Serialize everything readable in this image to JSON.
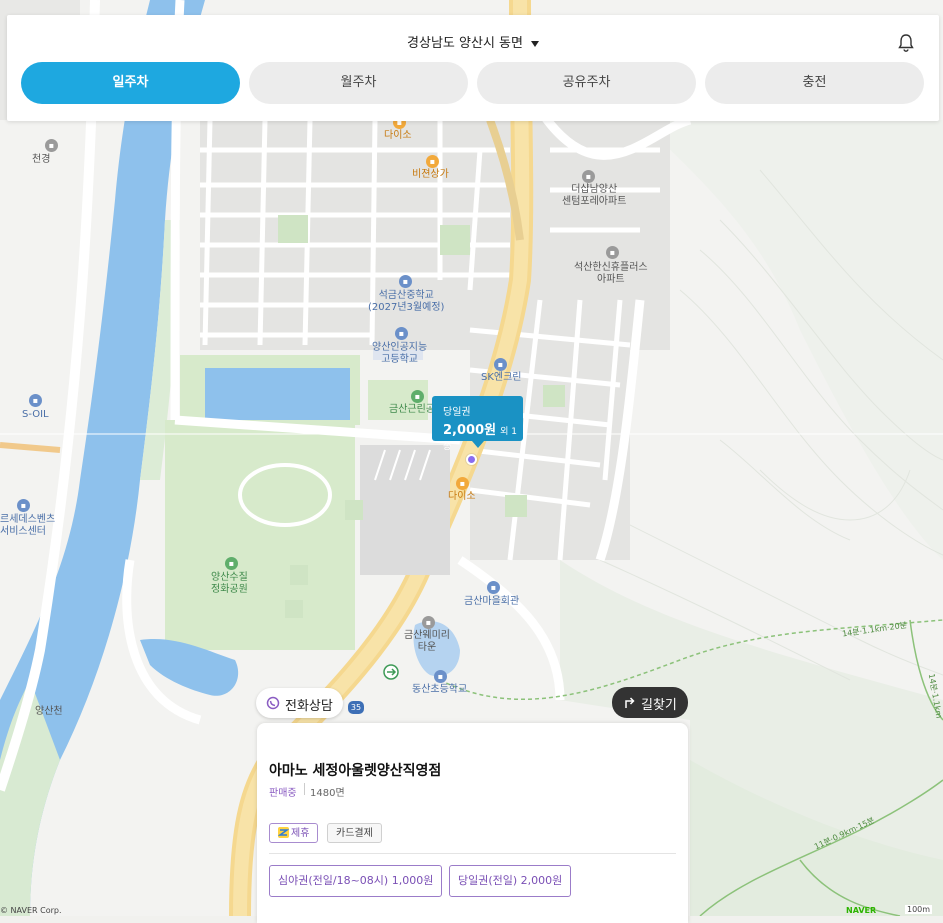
{
  "header": {
    "region": "경상남도 양산시 동면",
    "tabs": [
      {
        "label": "일주차",
        "active": true
      },
      {
        "label": "월주차",
        "active": false
      },
      {
        "label": "공유주차",
        "active": false
      },
      {
        "label": "충전",
        "active": false
      }
    ]
  },
  "map": {
    "labels": {
      "cheongyeong": "천경",
      "daiso_top": "다이소",
      "bijeon": "비젼상가",
      "deosyap": "더샵남양산\n센텀포레아파트",
      "seoksan": "석산한신휴플러스\n아파트",
      "seokgeumsan": "석금산중학교\n(2027년3월예정)",
      "yangsan_ai": "양산인공지능\n고등학교",
      "sk": "SK엔크린",
      "geumsan_park": "금산근린공원",
      "soil": "S-OIL",
      "benz": "르세데스벤츠\n서비스센터",
      "daiso_mid": "다이소",
      "sujeong": "양산수질\n정화공원",
      "hall": "금산마을회관",
      "town": "금산웨미리\n타운",
      "school": "동산초등학교",
      "yangsancheon": "양산천",
      "route": "35",
      "trail1": "14분·1.1km·20분",
      "trail2": "11분·0.9km·15분",
      "trail3": "14분·1.1km",
      "copyright": "© NAVER Corp.",
      "naver": "NAVER",
      "scale": "100m"
    },
    "marker": {
      "title": "당일권",
      "price": "2,000원",
      "extra": "외 1종"
    }
  },
  "buttons": {
    "phone": "전화상담",
    "route": "길찾기"
  },
  "card": {
    "name": "아마노 세정아울렛양산직영점",
    "status": "판매중",
    "spaces": "1480면",
    "tags": {
      "partner": "제휴",
      "card_pay": "카드결제"
    },
    "prices": [
      {
        "label": "심야권(전일/18~08시) 1,000원"
      },
      {
        "label": "당일권(전일) 2,000원"
      }
    ]
  },
  "colors": {
    "accent": "#1ea8e0",
    "marker": "#1a92c4",
    "purple": "#7a4fb5",
    "river": "#8ec1ec"
  }
}
